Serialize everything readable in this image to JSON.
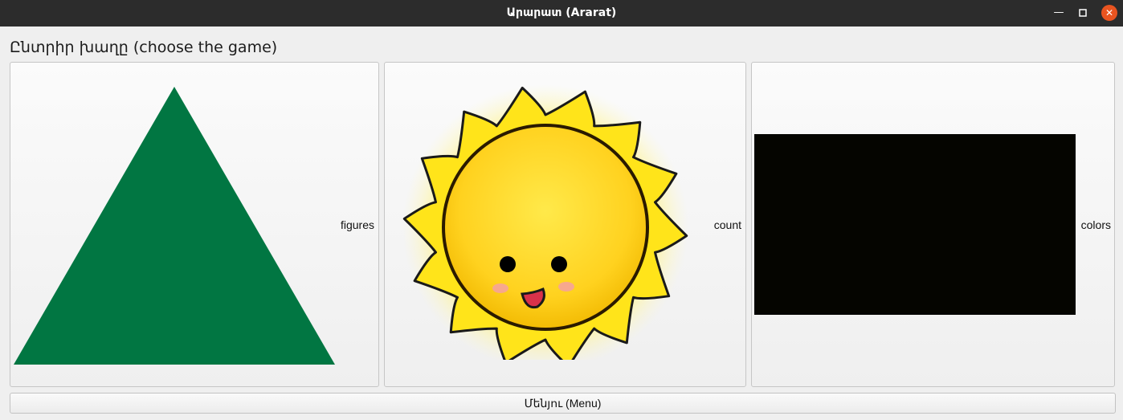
{
  "window": {
    "title": "Արարատ (Ararat)",
    "controls": {
      "minimize_icon": "minimize-icon",
      "maximize_icon": "maximize-icon",
      "close_icon": "close-icon"
    }
  },
  "heading": "Ընտրիր խաղը (choose the game)",
  "games": [
    {
      "label": "figures",
      "image": "green-triangle",
      "color": "#017642"
    },
    {
      "label": "count",
      "image": "smiling-sun",
      "color": "#ffe000"
    },
    {
      "label": "colors",
      "image": "black-rectangle",
      "color": "#050500"
    }
  ],
  "menu_button": "Մենյու (Menu)",
  "colors": {
    "titlebar": "#2c2c2c",
    "close": "#e95420",
    "background": "#efefef"
  }
}
